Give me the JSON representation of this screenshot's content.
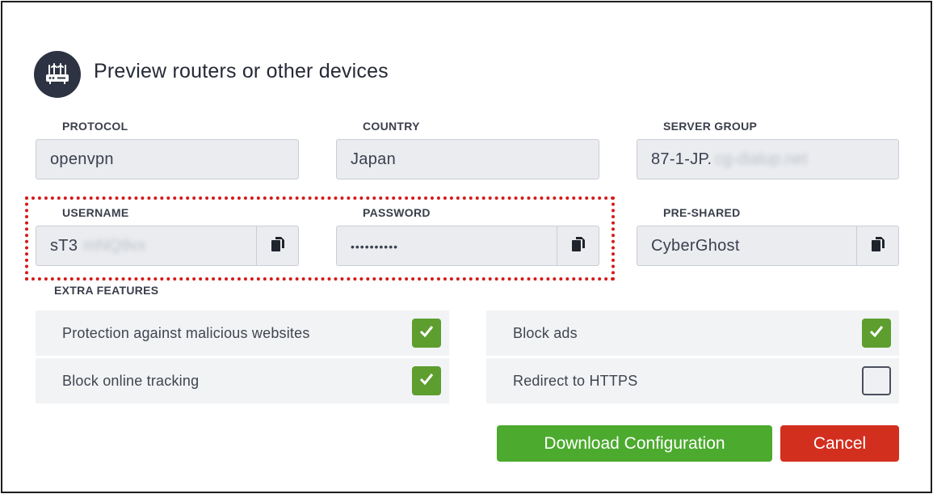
{
  "dialog": {
    "title": "Preview routers or other devices",
    "header_icon": "router-icon"
  },
  "fields": {
    "protocol": {
      "label": "PROTOCOL",
      "value": "openvpn"
    },
    "country": {
      "label": "COUNTRY",
      "value": "Japan"
    },
    "server_group": {
      "label": "SERVER GROUP",
      "value": "87-1-JP.",
      "blurred_suffix": "cg-dialup.net"
    },
    "username": {
      "label": "USERNAME",
      "value": "sT3",
      "blurred_suffix": "mNQ9vx",
      "copy_icon": "copy-icon"
    },
    "password": {
      "label": "PASSWORD",
      "value": "••••••••••",
      "copy_icon": "copy-icon"
    },
    "pre_shared": {
      "label": "PRE-SHARED",
      "value": "CyberGhost",
      "copy_icon": "copy-icon"
    }
  },
  "extra_features": {
    "label": "EXTRA FEATURES",
    "items": [
      {
        "label": "Protection against malicious websites",
        "checked": true
      },
      {
        "label": "Block ads",
        "checked": true
      },
      {
        "label": "Block online tracking",
        "checked": true
      },
      {
        "label": "Redirect to HTTPS",
        "checked": false
      }
    ]
  },
  "buttons": {
    "download": "Download Configuration",
    "cancel": "Cancel"
  },
  "colors": {
    "highlight_border": "#d51919",
    "checkbox_on": "#5d9e2f",
    "download_button": "#4caa2e",
    "cancel_button": "#d32f1f",
    "header_icon_bg": "#2d3342"
  }
}
